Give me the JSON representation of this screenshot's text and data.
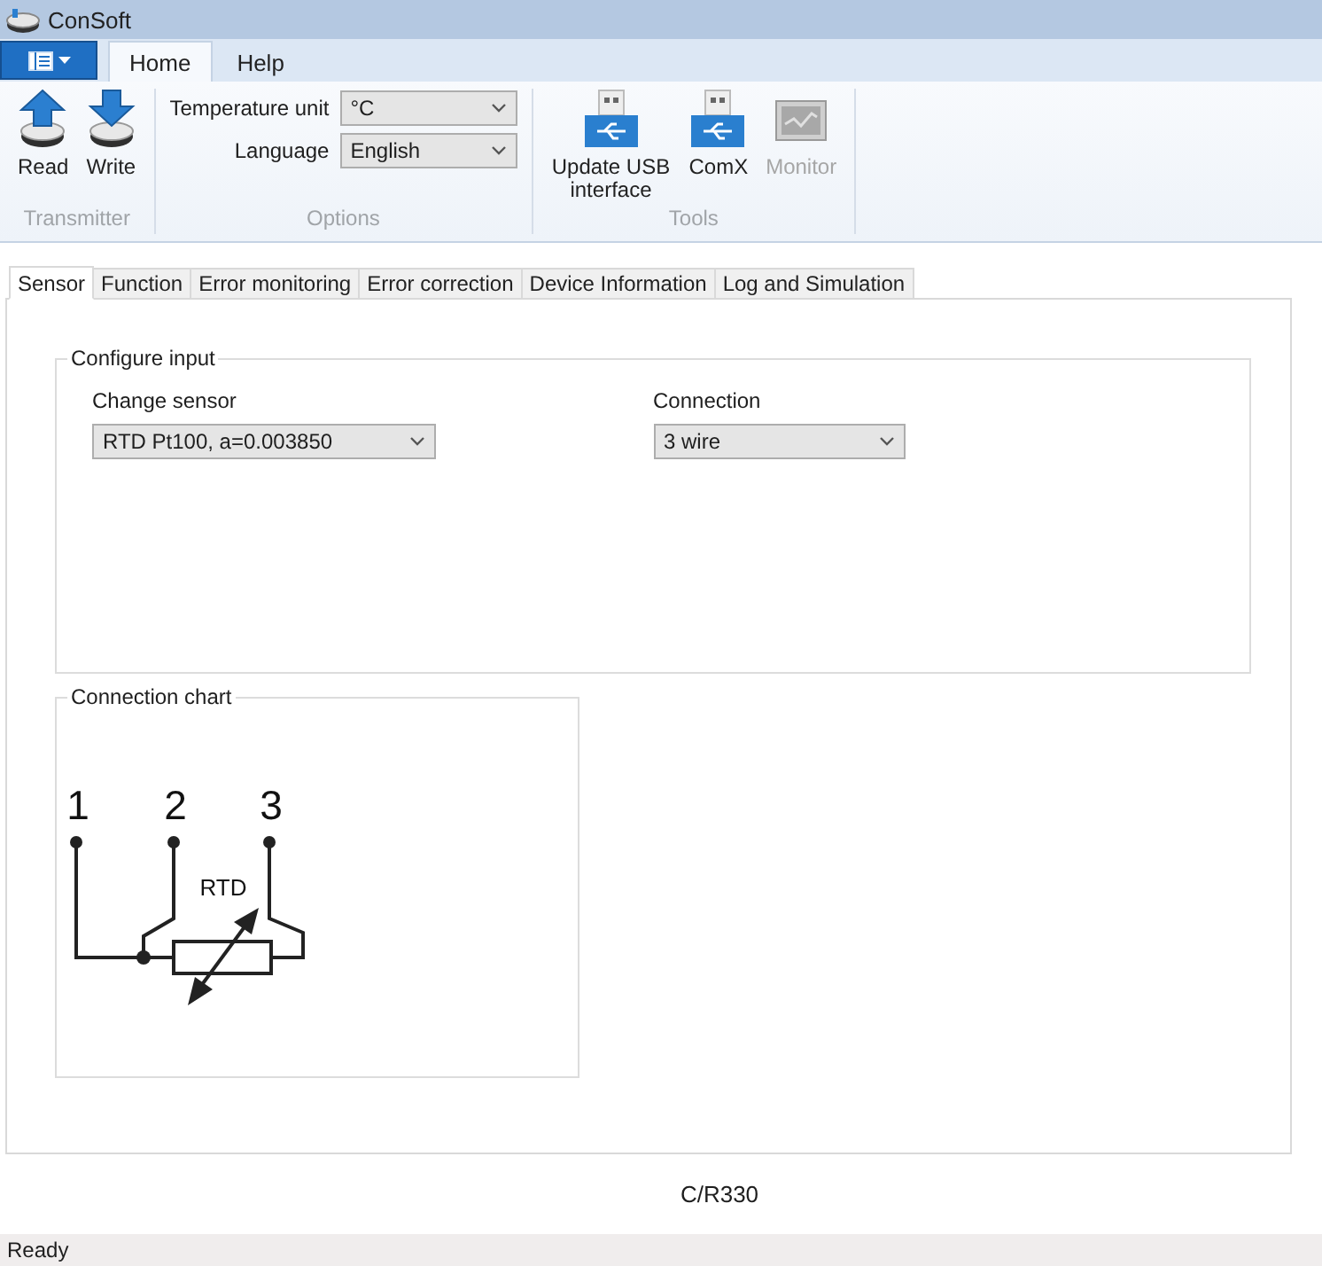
{
  "window": {
    "title": "ConSoft"
  },
  "ribbon": {
    "tabs": [
      {
        "label": "Home",
        "selected": true
      },
      {
        "label": "Help",
        "selected": false
      }
    ],
    "groups": [
      {
        "title": "Transmitter",
        "kind": "buttons",
        "items": [
          {
            "label": "Read",
            "kind": "read",
            "disabled": false
          },
          {
            "label": "Write",
            "kind": "write",
            "disabled": false
          }
        ]
      },
      {
        "title": "Options",
        "kind": "fields",
        "fields": [
          {
            "label": "Temperature unit",
            "value": "°C"
          },
          {
            "label": "Language",
            "value": "English"
          }
        ]
      },
      {
        "title": "Tools",
        "kind": "buttons",
        "items": [
          {
            "label": "Update USB interface",
            "kind": "usb",
            "disabled": false
          },
          {
            "label": "ComX",
            "kind": "usb",
            "disabled": false
          },
          {
            "label": "Monitor",
            "kind": "monitor",
            "disabled": true
          }
        ]
      }
    ]
  },
  "tabs": [
    {
      "label": "Sensor",
      "selected": true
    },
    {
      "label": "Function",
      "selected": false
    },
    {
      "label": "Error monitoring",
      "selected": false
    },
    {
      "label": "Error correction",
      "selected": false
    },
    {
      "label": "Device Information",
      "selected": false
    },
    {
      "label": "Log and Simulation",
      "selected": false
    }
  ],
  "configure_input": {
    "title": "Configure input",
    "fields": [
      {
        "label": "Change sensor",
        "value": "RTD Pt100, a=0.003850"
      },
      {
        "label": "Connection",
        "value": "3 wire"
      }
    ]
  },
  "connection_chart": {
    "title": "Connection chart",
    "terminals": [
      "1",
      "2",
      "3"
    ],
    "element_label": "RTD"
  },
  "footer": "C/R330",
  "status_bar": "Ready"
}
